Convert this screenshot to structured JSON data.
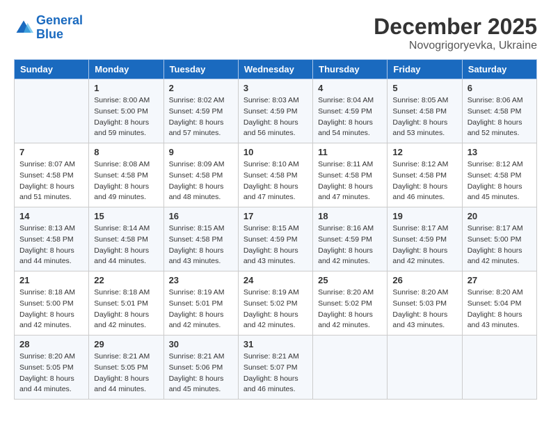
{
  "logo": {
    "line1": "General",
    "line2": "Blue"
  },
  "title": "December 2025",
  "subtitle": "Novogrigoryevka, Ukraine",
  "headers": [
    "Sunday",
    "Monday",
    "Tuesday",
    "Wednesday",
    "Thursday",
    "Friday",
    "Saturday"
  ],
  "weeks": [
    [
      {
        "day": "",
        "info": ""
      },
      {
        "day": "1",
        "info": "Sunrise: 8:00 AM\nSunset: 5:00 PM\nDaylight: 8 hours\nand 59 minutes."
      },
      {
        "day": "2",
        "info": "Sunrise: 8:02 AM\nSunset: 4:59 PM\nDaylight: 8 hours\nand 57 minutes."
      },
      {
        "day": "3",
        "info": "Sunrise: 8:03 AM\nSunset: 4:59 PM\nDaylight: 8 hours\nand 56 minutes."
      },
      {
        "day": "4",
        "info": "Sunrise: 8:04 AM\nSunset: 4:59 PM\nDaylight: 8 hours\nand 54 minutes."
      },
      {
        "day": "5",
        "info": "Sunrise: 8:05 AM\nSunset: 4:58 PM\nDaylight: 8 hours\nand 53 minutes."
      },
      {
        "day": "6",
        "info": "Sunrise: 8:06 AM\nSunset: 4:58 PM\nDaylight: 8 hours\nand 52 minutes."
      }
    ],
    [
      {
        "day": "7",
        "info": "Sunrise: 8:07 AM\nSunset: 4:58 PM\nDaylight: 8 hours\nand 51 minutes."
      },
      {
        "day": "8",
        "info": "Sunrise: 8:08 AM\nSunset: 4:58 PM\nDaylight: 8 hours\nand 49 minutes."
      },
      {
        "day": "9",
        "info": "Sunrise: 8:09 AM\nSunset: 4:58 PM\nDaylight: 8 hours\nand 48 minutes."
      },
      {
        "day": "10",
        "info": "Sunrise: 8:10 AM\nSunset: 4:58 PM\nDaylight: 8 hours\nand 47 minutes."
      },
      {
        "day": "11",
        "info": "Sunrise: 8:11 AM\nSunset: 4:58 PM\nDaylight: 8 hours\nand 47 minutes."
      },
      {
        "day": "12",
        "info": "Sunrise: 8:12 AM\nSunset: 4:58 PM\nDaylight: 8 hours\nand 46 minutes."
      },
      {
        "day": "13",
        "info": "Sunrise: 8:12 AM\nSunset: 4:58 PM\nDaylight: 8 hours\nand 45 minutes."
      }
    ],
    [
      {
        "day": "14",
        "info": "Sunrise: 8:13 AM\nSunset: 4:58 PM\nDaylight: 8 hours\nand 44 minutes."
      },
      {
        "day": "15",
        "info": "Sunrise: 8:14 AM\nSunset: 4:58 PM\nDaylight: 8 hours\nand 44 minutes."
      },
      {
        "day": "16",
        "info": "Sunrise: 8:15 AM\nSunset: 4:58 PM\nDaylight: 8 hours\nand 43 minutes."
      },
      {
        "day": "17",
        "info": "Sunrise: 8:15 AM\nSunset: 4:59 PM\nDaylight: 8 hours\nand 43 minutes."
      },
      {
        "day": "18",
        "info": "Sunrise: 8:16 AM\nSunset: 4:59 PM\nDaylight: 8 hours\nand 42 minutes."
      },
      {
        "day": "19",
        "info": "Sunrise: 8:17 AM\nSunset: 4:59 PM\nDaylight: 8 hours\nand 42 minutes."
      },
      {
        "day": "20",
        "info": "Sunrise: 8:17 AM\nSunset: 5:00 PM\nDaylight: 8 hours\nand 42 minutes."
      }
    ],
    [
      {
        "day": "21",
        "info": "Sunrise: 8:18 AM\nSunset: 5:00 PM\nDaylight: 8 hours\nand 42 minutes."
      },
      {
        "day": "22",
        "info": "Sunrise: 8:18 AM\nSunset: 5:01 PM\nDaylight: 8 hours\nand 42 minutes."
      },
      {
        "day": "23",
        "info": "Sunrise: 8:19 AM\nSunset: 5:01 PM\nDaylight: 8 hours\nand 42 minutes."
      },
      {
        "day": "24",
        "info": "Sunrise: 8:19 AM\nSunset: 5:02 PM\nDaylight: 8 hours\nand 42 minutes."
      },
      {
        "day": "25",
        "info": "Sunrise: 8:20 AM\nSunset: 5:02 PM\nDaylight: 8 hours\nand 42 minutes."
      },
      {
        "day": "26",
        "info": "Sunrise: 8:20 AM\nSunset: 5:03 PM\nDaylight: 8 hours\nand 43 minutes."
      },
      {
        "day": "27",
        "info": "Sunrise: 8:20 AM\nSunset: 5:04 PM\nDaylight: 8 hours\nand 43 minutes."
      }
    ],
    [
      {
        "day": "28",
        "info": "Sunrise: 8:20 AM\nSunset: 5:05 PM\nDaylight: 8 hours\nand 44 minutes."
      },
      {
        "day": "29",
        "info": "Sunrise: 8:21 AM\nSunset: 5:05 PM\nDaylight: 8 hours\nand 44 minutes."
      },
      {
        "day": "30",
        "info": "Sunrise: 8:21 AM\nSunset: 5:06 PM\nDaylight: 8 hours\nand 45 minutes."
      },
      {
        "day": "31",
        "info": "Sunrise: 8:21 AM\nSunset: 5:07 PM\nDaylight: 8 hours\nand 46 minutes."
      },
      {
        "day": "",
        "info": ""
      },
      {
        "day": "",
        "info": ""
      },
      {
        "day": "",
        "info": ""
      }
    ]
  ]
}
